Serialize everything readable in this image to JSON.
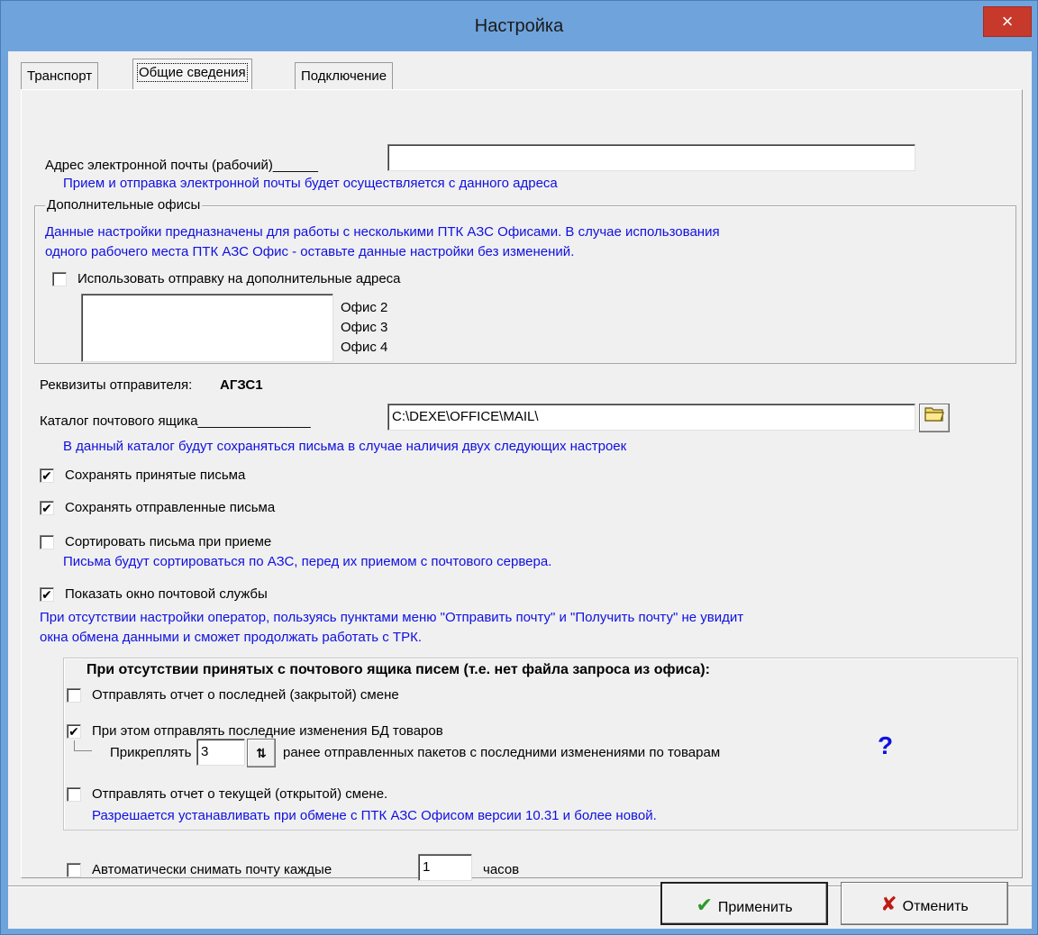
{
  "window": {
    "title": "Настройка",
    "close": "×"
  },
  "tabs": [
    {
      "label": "Транспорт"
    },
    {
      "label": "Общие сведения"
    },
    {
      "label": "Подключение"
    }
  ],
  "email": {
    "label": "Адрес электронной почты (рабочий)______",
    "value": "",
    "hint": "Прием и отправка электронной почты будет осуществляется с данного адреса"
  },
  "offices": {
    "group_title": "Дополнительные офисы",
    "info_line1": "Данные настройки предназначены для работы с несколькими ПТК АЗС Офисами. В случае использования",
    "info_line2": "одного рабочего места ПТК АЗС Офис - оставьте данные настройки без изменений.",
    "use_extra_label": "Использовать отправку на дополнительные адреса",
    "use_extra_checked": false,
    "items": [
      "Офис 2",
      "Офис 3",
      "Офис 4"
    ]
  },
  "sender": {
    "label": "Реквизиты отправителя:",
    "value": "АГЗС1"
  },
  "mailbox": {
    "label": "Каталог почтового ящика_______________",
    "value": "C:\\DEXE\\OFFICE\\MAIL\\",
    "hint": "В данный каталог будут сохраняться письма в случае наличия двух следующих настроек"
  },
  "options": {
    "save_received": {
      "label": "Сохранять принятые письма",
      "checked": true,
      "mark": "✔"
    },
    "save_sent": {
      "label": "Сохранять отправленные письма",
      "checked": true,
      "mark": "✔"
    },
    "sort_on_receive": {
      "label": "Сортировать письма при приеме",
      "checked": false,
      "mark": ""
    },
    "sort_hint": "Письма будут сортироваться по АЗС, перед их приемом с почтового сервера.",
    "show_mail_window": {
      "label": "Показать окно почтовой службы",
      "checked": true,
      "mark": "✔"
    },
    "show_hint_line1": "При отсутствии настройки оператор, пользуясь пунктами меню \"Отправить почту\" и \"Получить почту\" не увидит",
    "show_hint_line2": "окна обмена данными и сможет продолжать работать с ТРК."
  },
  "no_mail": {
    "heading": "При отсутствии принятых с почтового ящика писем (т.е. нет файла запроса из офиса):",
    "send_last_shift": {
      "label": "Отправлять отчет о последней (закрытой) смене",
      "checked": false,
      "mark": ""
    },
    "send_db_changes": {
      "label": "При этом отправлять последние изменения БД товаров",
      "checked": true,
      "mark": "✔"
    },
    "attach_label": "Прикреплять",
    "attach_value": "3",
    "attach_suffix": "ранее отправленных пакетов с последними изменениями по товарам",
    "help": "?",
    "send_current_shift": {
      "label": "Отправлять отчет о текущей (открытой) смене.",
      "checked": false,
      "mark": ""
    },
    "current_hint": "Разрешается устанавливать при обмене с ПТК АЗС Офисом версии 10.31 и более новой."
  },
  "auto": {
    "label": "Автоматически снимать почту каждые",
    "value": "1",
    "unit": "часов",
    "checked": false,
    "mark": ""
  },
  "buttons": {
    "apply": "Применить",
    "cancel": "Отменить"
  },
  "colors": {
    "titlebar": "#6fa3dc",
    "hint_text": "#1010e0",
    "close": "#c7392b"
  }
}
